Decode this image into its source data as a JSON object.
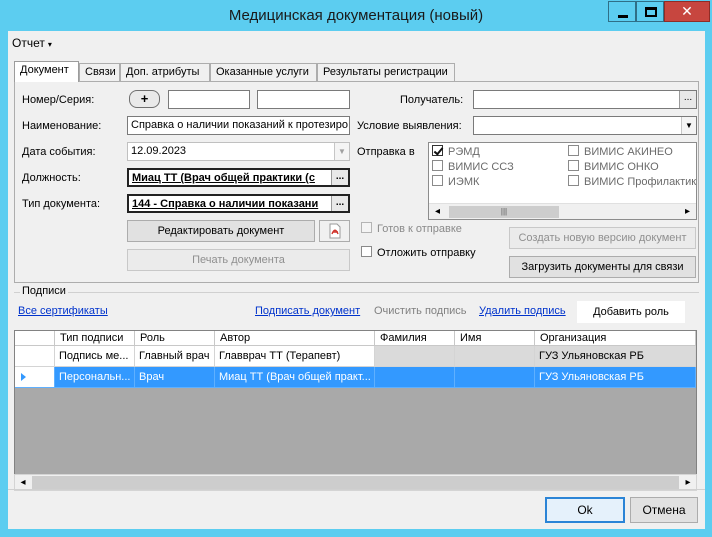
{
  "window": {
    "title": "Медицинская документация (новый)",
    "min_glyph": "",
    "max_glyph": "",
    "close_glyph": "✕"
  },
  "menu": {
    "report": "Отчет",
    "caret": "▾"
  },
  "tabs": [
    {
      "label": "Документ",
      "active": true
    },
    {
      "label": "Связи"
    },
    {
      "label": "Доп. атрибуты"
    },
    {
      "label": "Оказанные услуги"
    },
    {
      "label": "Результаты регистрации"
    }
  ],
  "form": {
    "number_label": "Номер/Серия:",
    "plus_label": "+",
    "number_value": "",
    "series_value": "",
    "name_label": "Наименование:",
    "name_value": "Справка о наличии показаний к протезиро",
    "date_label": "Дата события:",
    "date_value": "12.09.2023",
    "position_label": "Должность:",
    "position_value": "Миац ТТ (Врач общей практики (с",
    "doctype_label": "Тип документа:",
    "doctype_value": "144 - Справка о наличии показани",
    "ellipsis": "...",
    "recipient_label": "Получатель:",
    "recipient_value": "",
    "condition_label": "Условие выявления:",
    "condition_value": "",
    "send_to_label": "Отправка в",
    "edit_doc_button": "Редактировать документ",
    "print_doc_button": "Печать документа",
    "ready_to_send": "Готов к отправке",
    "postpone_send": "Отложить отправку",
    "create_version_button": "Создать новую версию документ",
    "upload_docs_button": "Загрузить документы для связи"
  },
  "destinations": [
    {
      "label": "РЭМД",
      "checked": true
    },
    {
      "label": "ВИМИС ССЗ",
      "checked": false
    },
    {
      "label": "ИЭМК",
      "checked": false
    },
    {
      "label": "ВИМИС АКИНЕО",
      "checked": false
    },
    {
      "label": "ВИМИС ОНКО",
      "checked": false
    },
    {
      "label": "ВИМИС Профилактика",
      "checked": false
    }
  ],
  "signatures": {
    "group_title": "Подписи",
    "all_certs_link": "Все сертификаты",
    "sign_link": "Подписать документ",
    "clear_sign": "Очистить подпись",
    "delete_sign_link": "Удалить подпись",
    "add_role_button": "Добавить роль",
    "columns": [
      "Тип подписи",
      "Роль",
      "Автор",
      "Фамилия",
      "Имя",
      "Организация"
    ],
    "rows": [
      [
        "Подпись ме...",
        "Главный врач",
        "Главврач ТТ (Терапевт)",
        "",
        "",
        "ГУЗ Ульяновская РБ"
      ],
      [
        "Персональн...",
        "Врач",
        "Миац ТТ (Врач общей практ...",
        "",
        "",
        "ГУЗ Ульяновская РБ"
      ]
    ]
  },
  "footer": {
    "ok": "Ok",
    "cancel": "Отмена"
  },
  "icons": {
    "pdf": "pdf-icon",
    "scroll_left": "◂",
    "scroll_right": "▸",
    "thumb": "|||"
  }
}
